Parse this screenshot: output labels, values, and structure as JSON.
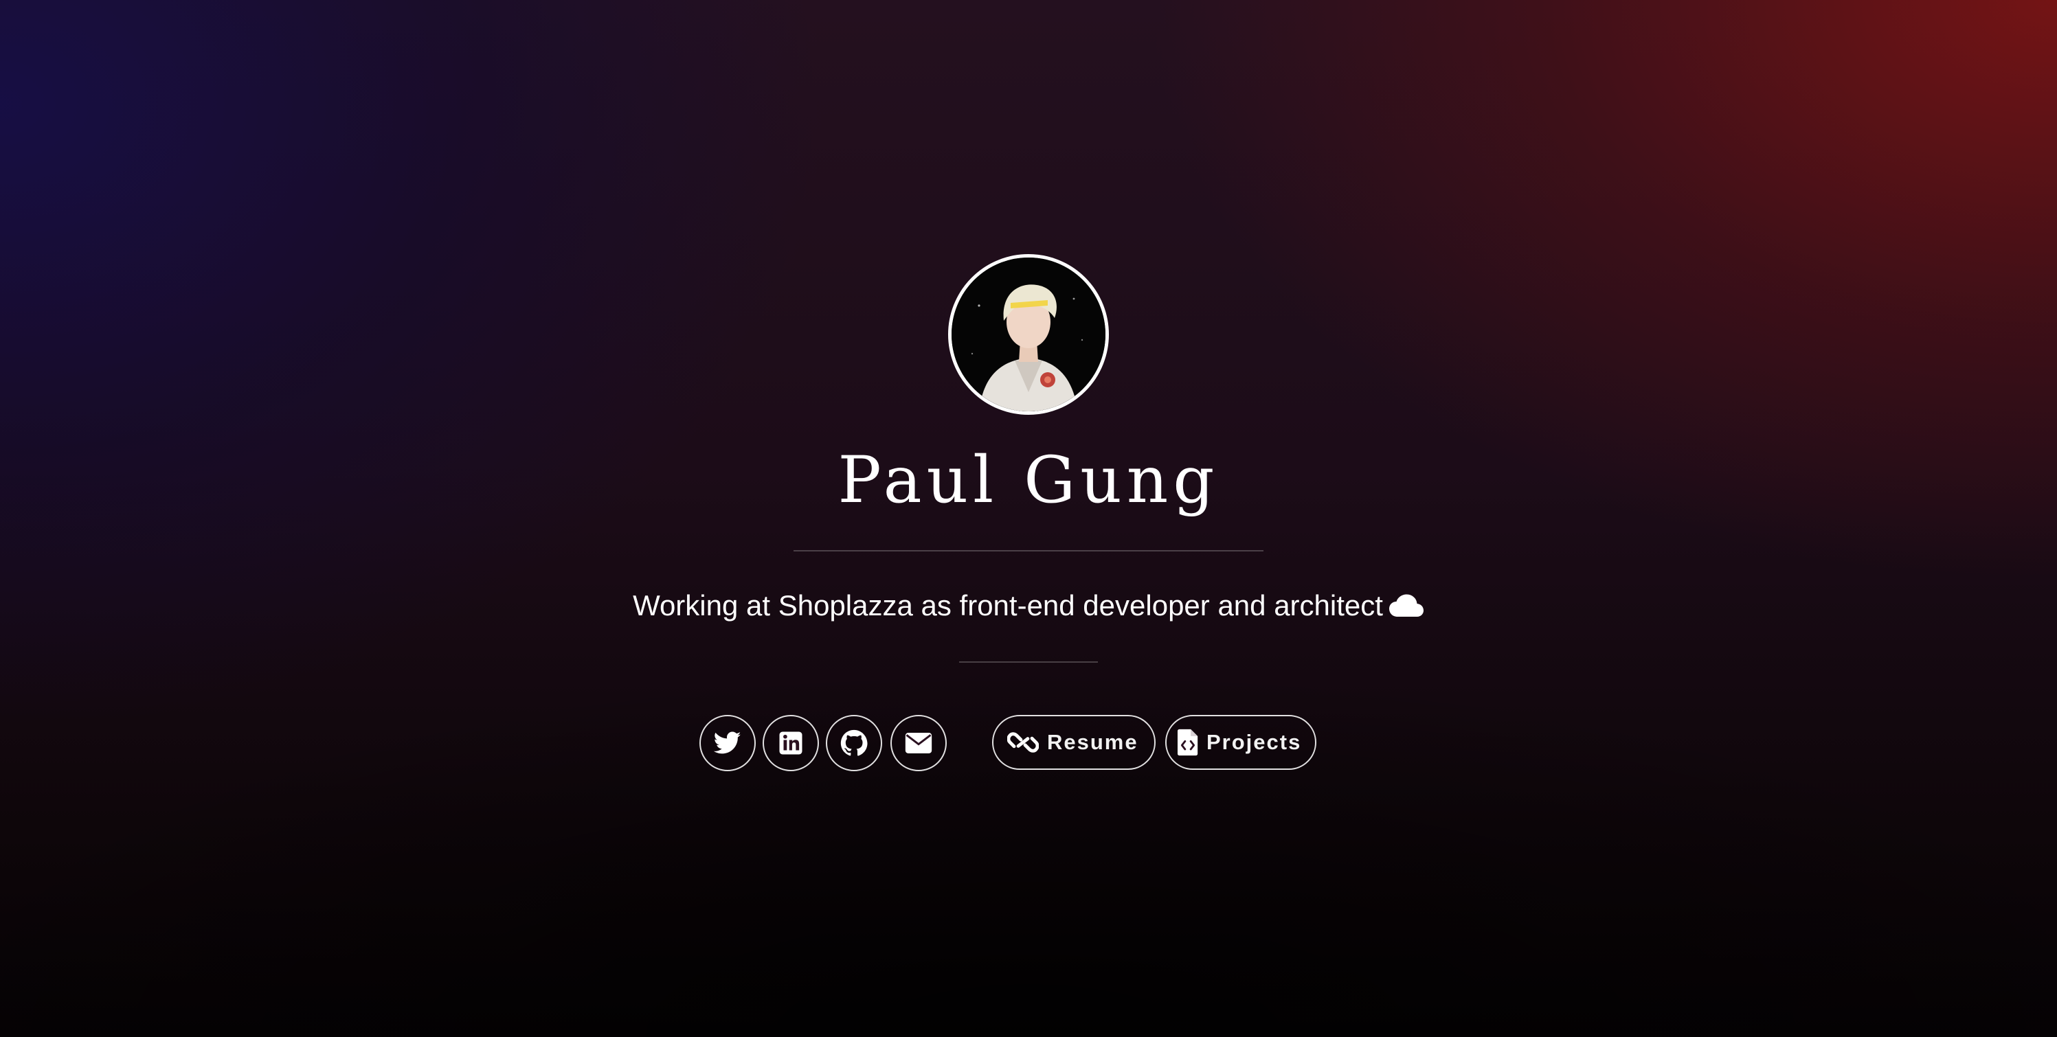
{
  "profile": {
    "name": "Paul Gung",
    "tagline": "Working at Shoplazza as front-end developer and architect",
    "tagline_icon": "cloud-icon",
    "avatar": "avatar"
  },
  "social": [
    {
      "icon": "twitter-icon"
    },
    {
      "icon": "linkedin-icon"
    },
    {
      "icon": "github-icon"
    },
    {
      "icon": "envelope-icon"
    }
  ],
  "links": {
    "resume": {
      "label": "Resume",
      "icon": "link-icon"
    },
    "projects": {
      "label": "Projects",
      "icon": "file-code-icon"
    }
  },
  "colors": {
    "background_left": "#120c3a",
    "background_right": "#6a1416",
    "background_bottom": "#050204",
    "text": "#ffffff"
  }
}
